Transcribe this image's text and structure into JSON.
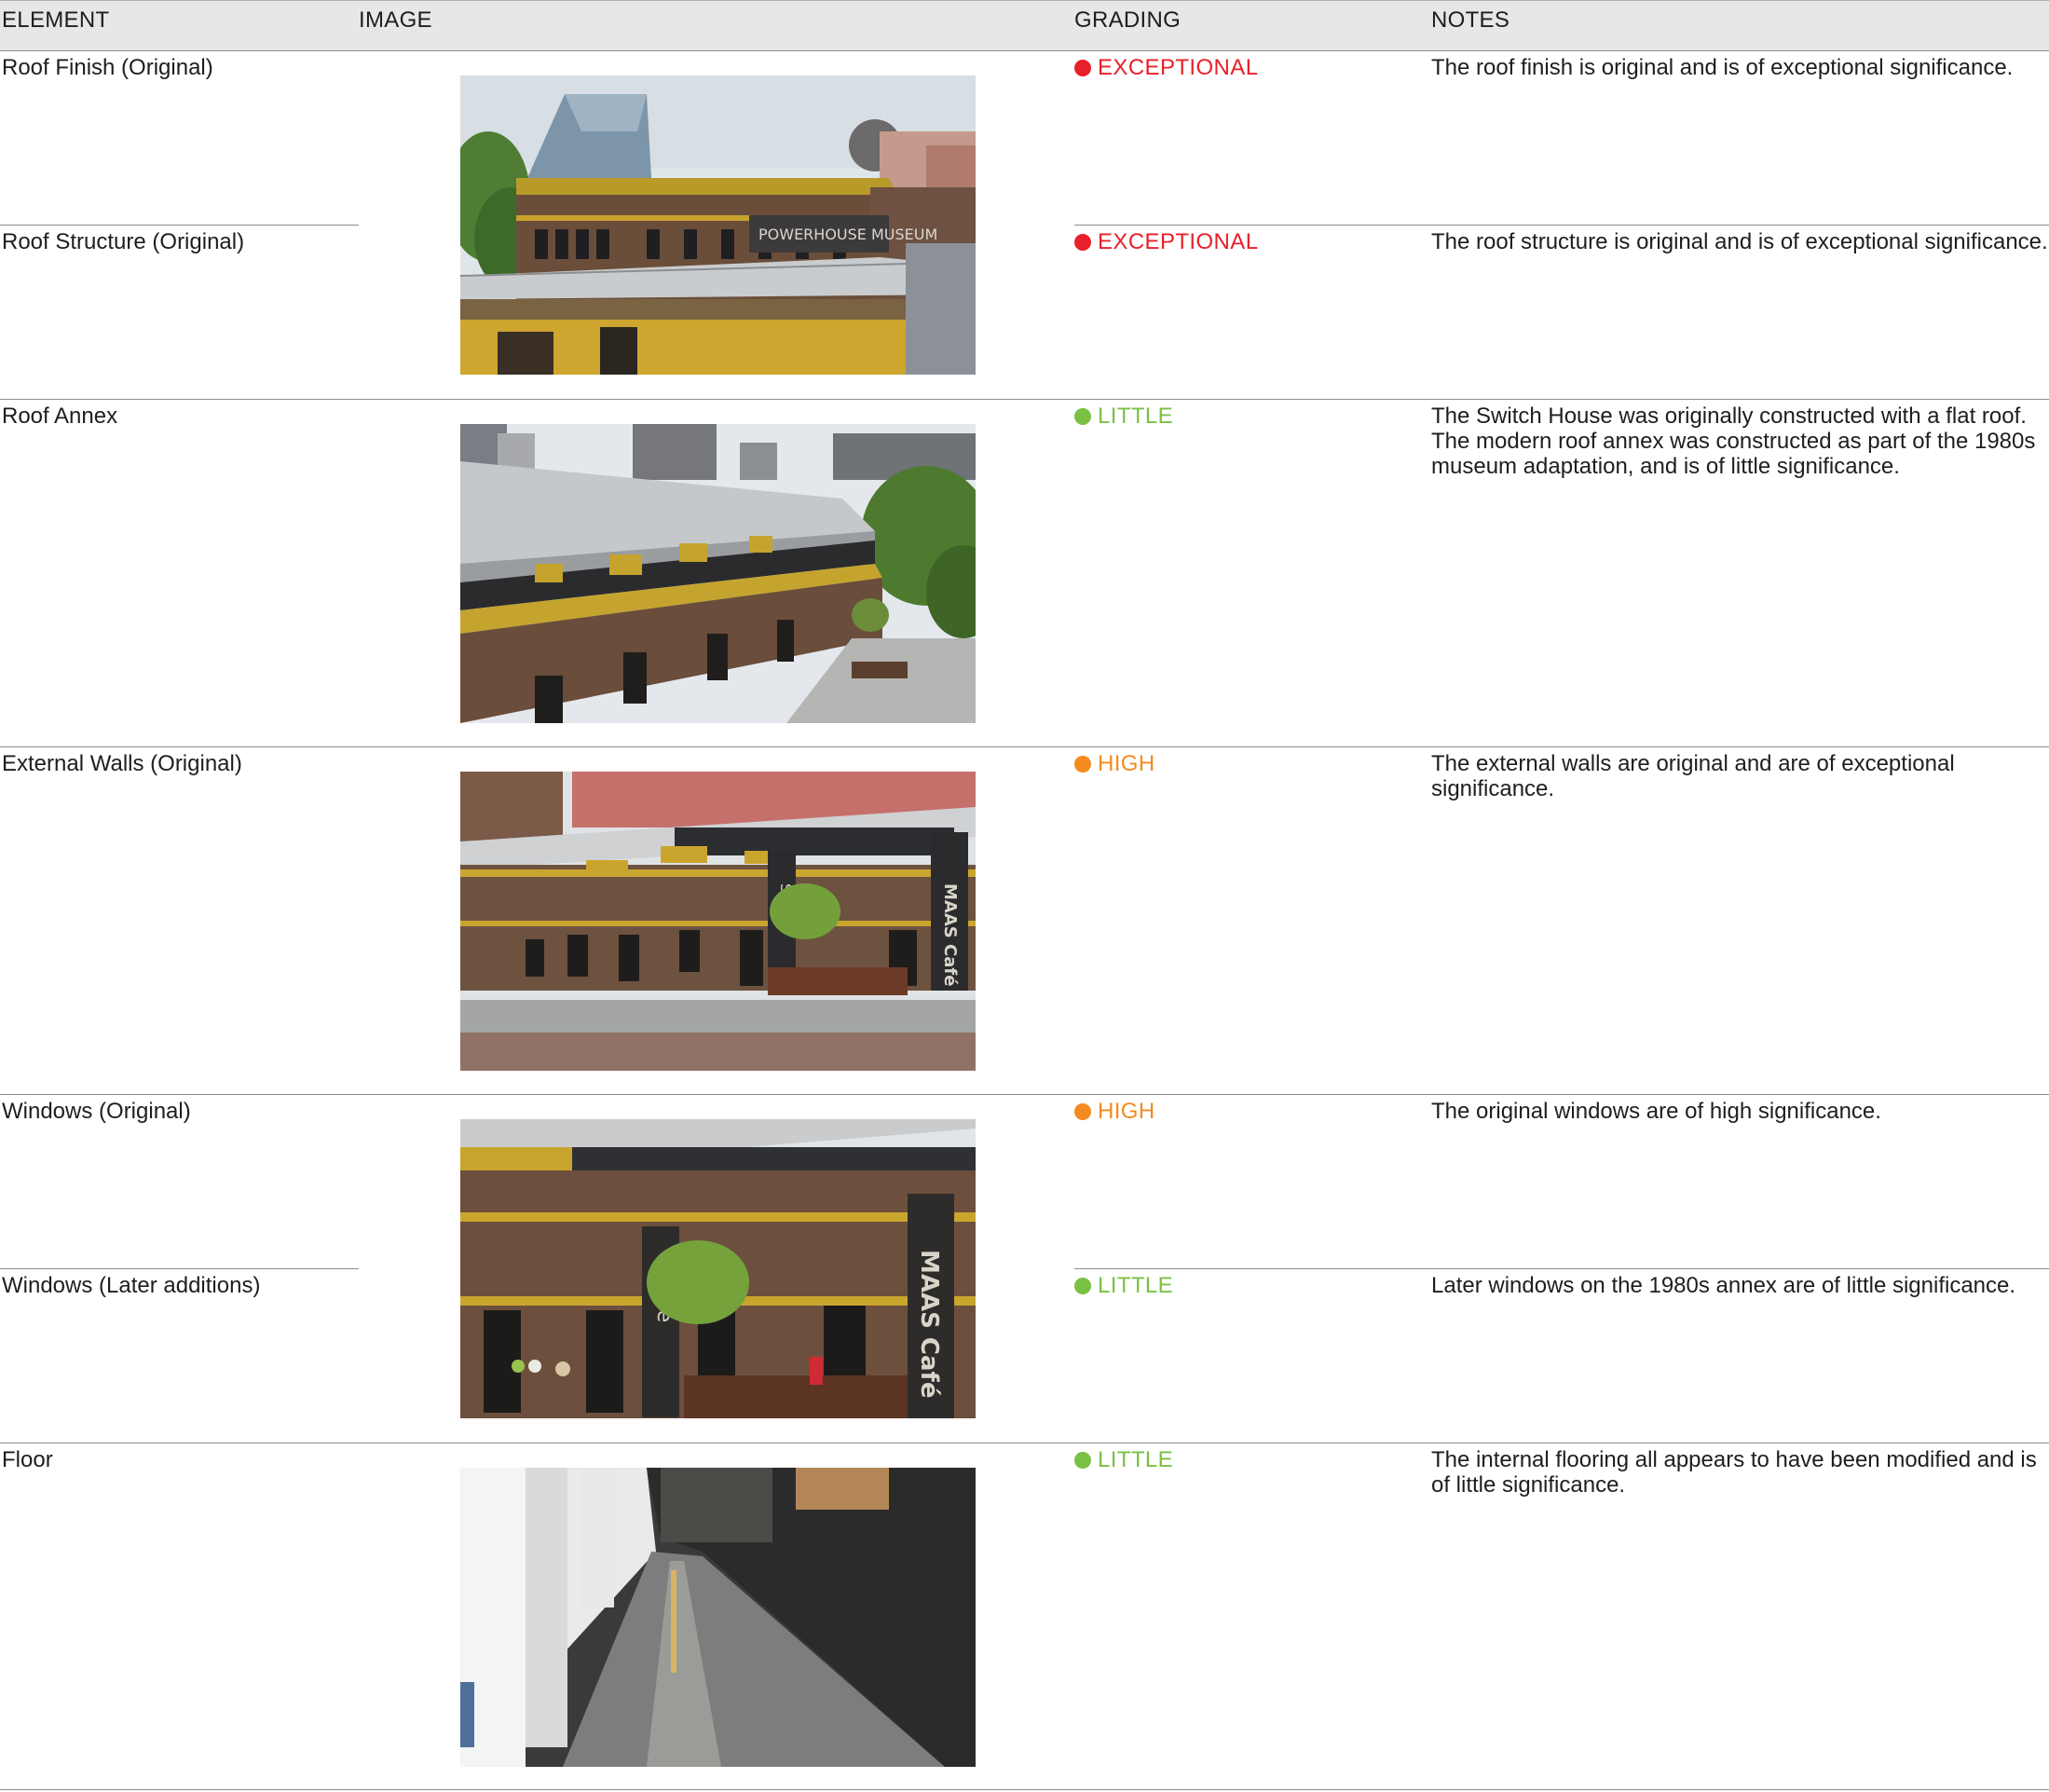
{
  "headers": {
    "element": "ELEMENT",
    "image": "IMAGE",
    "grading": "GRADING",
    "notes": "NOTES"
  },
  "colors": {
    "exceptional": "#e8202a",
    "high": "#f38b1f",
    "little": "#7ac143",
    "header_bg": "#e6e7e8"
  },
  "rows": [
    {
      "element": "Roof Finish (Original)",
      "grading": "EXCEPTIONAL",
      "grade_level": "exceptional",
      "notes": "The roof finish is original and is of exceptional significance."
    },
    {
      "element": "Roof Structure (Original)",
      "grading": "EXCEPTIONAL",
      "grade_level": "exceptional",
      "notes": "The roof structure is original and is of exceptional significance."
    },
    {
      "element": "Roof Annex",
      "grading": "LITTLE",
      "grade_level": "little",
      "notes": "The Switch House was originally constructed with a flat roof. The modern roof annex was constructed as part of the 1980s museum adaptation, and is of little significance."
    },
    {
      "element": "External Walls (Original)",
      "grading": "HIGH",
      "grade_level": "high",
      "notes": "The external walls are original and are of exceptional significance."
    },
    {
      "element": "Windows (Original)",
      "grading": "HIGH",
      "grade_level": "high",
      "notes": "The original windows are of high significance."
    },
    {
      "element": "Windows (Later additions)",
      "grading": "LITTLE",
      "grade_level": "little",
      "notes": "Later windows on the 1980s annex are of little significance."
    },
    {
      "element": "Floor",
      "grading": "LITTLE",
      "grade_level": "little",
      "notes": "The internal flooring all appears to have been modified and is of little significance."
    }
  ],
  "photos": [
    {
      "name": "roof-finish-photo",
      "sign_text": "POWERHOUSE MUSEUM"
    },
    {
      "name": "roof-annex-photo"
    },
    {
      "name": "external-walls-photo",
      "sign_text_1": "Store",
      "sign_text_2": "MAAS Café"
    },
    {
      "name": "windows-photo",
      "sign_text_1": "Store",
      "sign_text_2": "MAAS Café"
    },
    {
      "name": "floor-photo"
    }
  ]
}
